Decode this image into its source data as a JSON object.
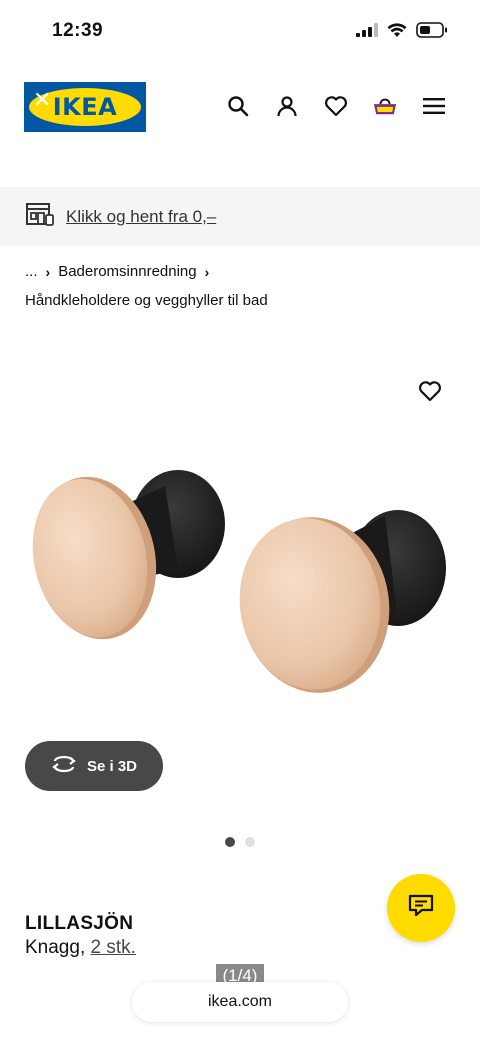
{
  "status_bar": {
    "time": "12:39",
    "icons": [
      "cellular-signal-icon",
      "wifi-icon",
      "battery-icon"
    ]
  },
  "header": {
    "logo_text": "IKEA",
    "logo_close_symbol": "✕",
    "icons": [
      "search-icon",
      "account-icon",
      "heart-icon",
      "shopping-basket-icon",
      "menu-icon"
    ]
  },
  "pickup_banner": {
    "icon": "store-pickup-icon",
    "text": "Klikk og hent fra 0,–"
  },
  "breadcrumb": {
    "ellipsis": "...",
    "separator": "›",
    "item": "Baderomsinnredning",
    "category": "Håndkleholdere og vegghyller til bad"
  },
  "product_image": {
    "wishlist_icon": "heart-icon"
  },
  "view_3d": {
    "label": "Se i 3D",
    "icon": "rotate-3d-icon"
  },
  "carousel": {
    "total": 2,
    "active": 1
  },
  "product": {
    "name": "LILLASJÖN",
    "type": "Knagg,",
    "quantity": "2 stk."
  },
  "chat": {
    "icon": "chat-icon"
  },
  "browser": {
    "page_counter": "(1/4)",
    "url": "ikea.com"
  },
  "colors": {
    "ikea_blue": "#0058a3",
    "ikea_yellow": "#ffdb00",
    "button_dark": "#484848"
  }
}
